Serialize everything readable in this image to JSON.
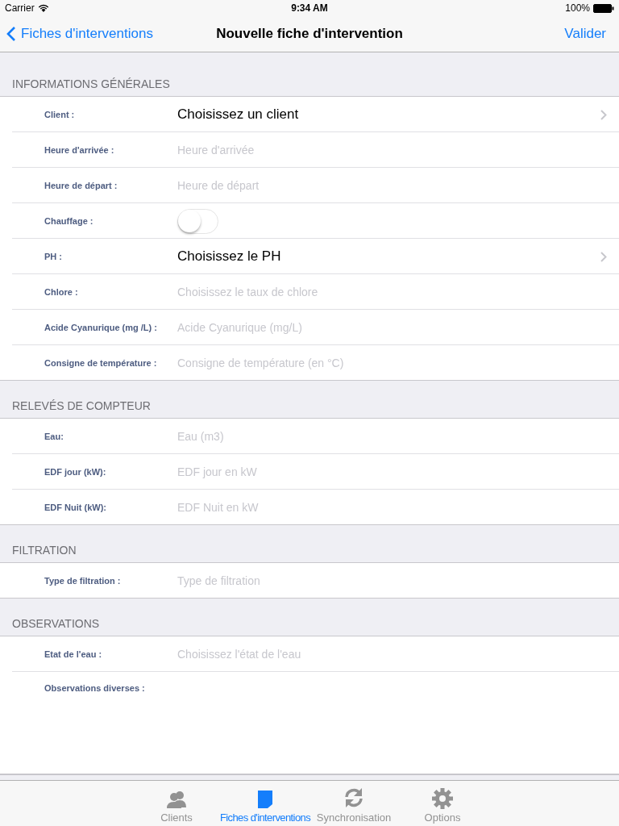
{
  "status_bar": {
    "carrier": "Carrier",
    "time": "9:34 AM",
    "battery": "100%"
  },
  "nav_bar": {
    "back": "Fiches d'interventions",
    "title": "Nouvelle fiche d'intervention",
    "action": "Valider"
  },
  "sections": [
    {
      "title": "INFORMATIONS GÉNÉRALES",
      "rows": [
        {
          "kind": "picker",
          "label": "Client :",
          "value": "Choisissez un client"
        },
        {
          "kind": "field",
          "label": "Heure d'arrivée :",
          "placeholder": "Heure d'arrivée"
        },
        {
          "kind": "field",
          "label": "Heure de départ :",
          "placeholder": "Heure de départ"
        },
        {
          "kind": "switch",
          "label": "Chauffage :",
          "on": false
        },
        {
          "kind": "picker",
          "label": "PH :",
          "value": "Choisissez le PH"
        },
        {
          "kind": "field",
          "label": "Chlore :",
          "placeholder": "Choisissez le taux de chlore"
        },
        {
          "kind": "field",
          "label": "Acide Cyanurique (mg /L) :",
          "placeholder": "Acide Cyanurique (mg/L)"
        },
        {
          "kind": "field",
          "label": "Consigne de température :",
          "placeholder": "Consigne de température (en °C)"
        }
      ]
    },
    {
      "title": "RELEVÉS DE COMPTEUR",
      "rows": [
        {
          "kind": "field",
          "label": "Eau:",
          "placeholder": "Eau (m3)"
        },
        {
          "kind": "field",
          "label": "EDF jour (kW):",
          "placeholder": "EDF jour en kW"
        },
        {
          "kind": "field",
          "label": "EDF Nuit (kW):",
          "placeholder": "EDF Nuit en kW"
        }
      ]
    },
    {
      "title": "FILTRATION",
      "rows": [
        {
          "kind": "field",
          "label": "Type de filtration :",
          "placeholder": "Type de filtration"
        }
      ]
    },
    {
      "title": "OBSERVATIONS",
      "rows": [
        {
          "kind": "field",
          "label": "Etat de l'eau :",
          "placeholder": "Choisissez l'état de l'eau"
        },
        {
          "kind": "textarea",
          "label": "Observations diverses :"
        }
      ]
    }
  ],
  "tabs": [
    {
      "kind": "clients",
      "label": "Clients",
      "selected": false
    },
    {
      "kind": "fiches",
      "label": "Fiches d'interventions",
      "selected": true
    },
    {
      "kind": "sync",
      "label": "Synchronisation",
      "selected": false
    },
    {
      "kind": "options",
      "label": "Options",
      "selected": false
    }
  ]
}
